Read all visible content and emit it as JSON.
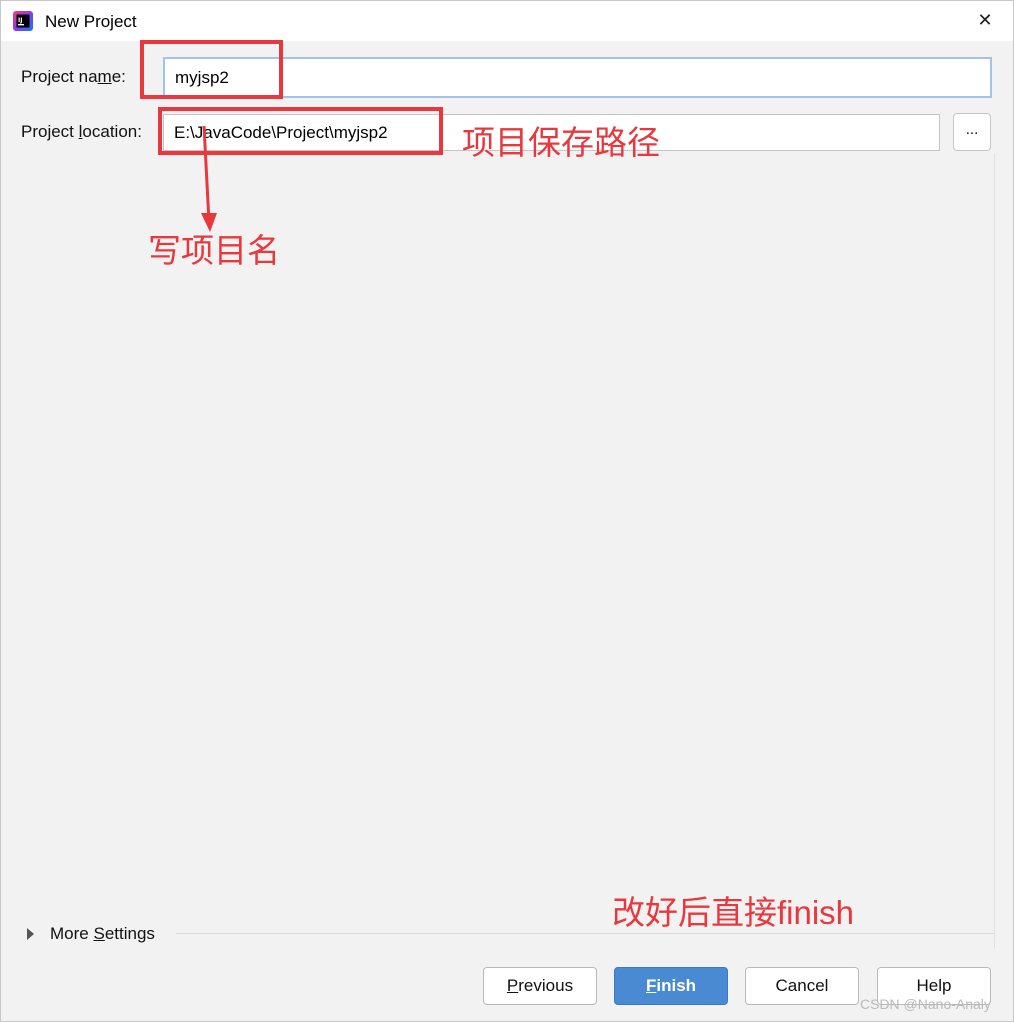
{
  "window": {
    "title": "New Project",
    "close_glyph": "✕",
    "app_icon": "intellij-idea-icon"
  },
  "form": {
    "project_name": {
      "label_pre": "Project na",
      "label_mnemonic": "m",
      "label_post": "e:",
      "value": "myjsp2"
    },
    "project_location": {
      "label_pre": "Project ",
      "label_mnemonic": "l",
      "label_post": "ocation:",
      "value": "E:\\JavaCode\\Project\\myjsp2"
    },
    "browse_label": "..."
  },
  "more_settings": {
    "label_pre": "More ",
    "label_mnemonic": "S",
    "label_post": "ettings"
  },
  "buttons": {
    "previous": {
      "mnemonic": "P",
      "rest": "revious"
    },
    "finish": {
      "mnemonic": "F",
      "rest": "inish"
    },
    "cancel": "Cancel",
    "help": "Help"
  },
  "annotations": {
    "location_note": "项目保存路径",
    "name_note": "写项目名",
    "finish_note": "改好后直接finish",
    "color": "#e8383d"
  },
  "watermark": "CSDN @Nano-Analy"
}
